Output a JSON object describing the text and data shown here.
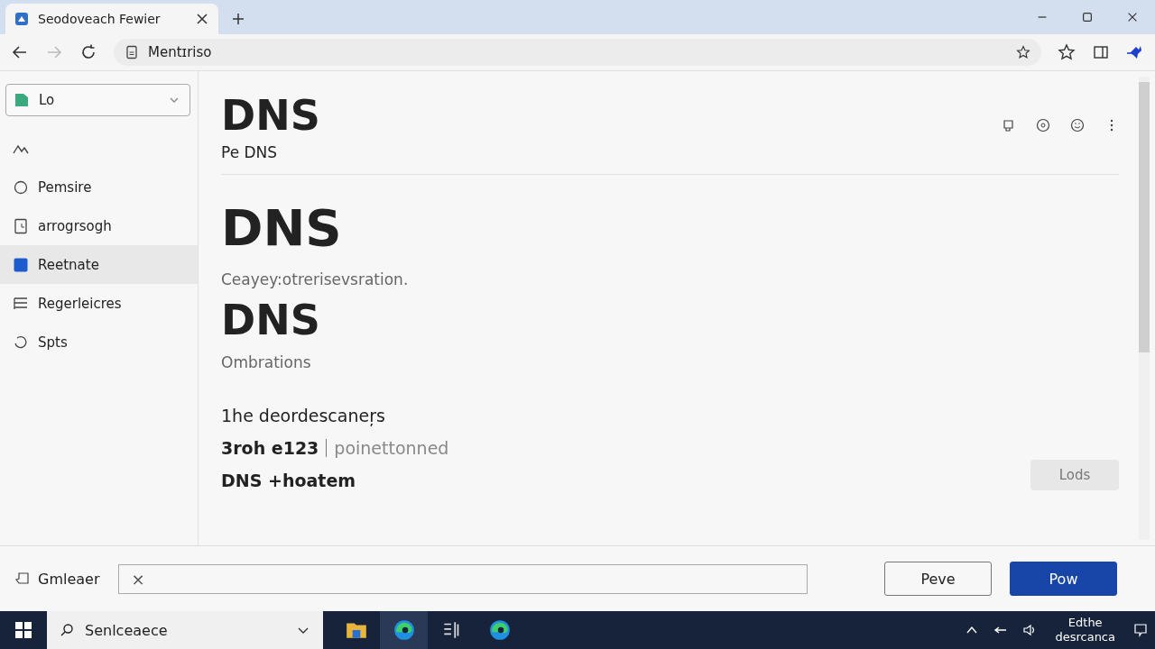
{
  "browser": {
    "tab_title": "Seodoveach Fewier",
    "address": "Mentɪriso"
  },
  "sidebar": {
    "dropdown": "Lo",
    "items": [
      {
        "kind": "chart",
        "selected": false
      },
      {
        "kind": "circle",
        "label": "Pemsire",
        "selected": false
      },
      {
        "kind": "doc",
        "label": "arrogrsogh",
        "selected": false
      },
      {
        "kind": "square",
        "label": "Reetnate",
        "selected": true
      },
      {
        "kind": "list",
        "label": "Regerleicres",
        "selected": false
      },
      {
        "kind": "refresh",
        "label": "Spts",
        "selected": false
      }
    ]
  },
  "content": {
    "title": "DNS",
    "subtitle": "Pe DNS",
    "sections": [
      {
        "kind": "heading",
        "text": "DNS"
      },
      {
        "kind": "note",
        "text": "Ceayey:otrerisevsration."
      },
      {
        "kind": "heading2",
        "text": "DNS"
      },
      {
        "kind": "note",
        "text": "Ombrations"
      },
      {
        "kind": "line",
        "text": "1he deordescaneŗs"
      },
      {
        "kind": "pair",
        "text": "3roh e123",
        "extra": "poinettonned"
      },
      {
        "kind": "bold",
        "text": "DNS +hoatem"
      }
    ],
    "action_button": "Lods"
  },
  "bottom_bar": {
    "label": "Gmleaer",
    "clear_symbol": "×",
    "buttons": [
      {
        "label": "Peve",
        "primary": false
      },
      {
        "label": "Pow",
        "primary": true
      }
    ]
  },
  "taskbar": {
    "search": "Senlceaece",
    "apps": [
      {
        "kind": "folder",
        "selected": false
      },
      {
        "kind": "edge",
        "selected": true
      },
      {
        "kind": "widgets",
        "selected": false
      },
      {
        "kind": "edge",
        "selected": false
      }
    ],
    "clock_time": "Edthe",
    "clock_date": "desrcanca"
  }
}
